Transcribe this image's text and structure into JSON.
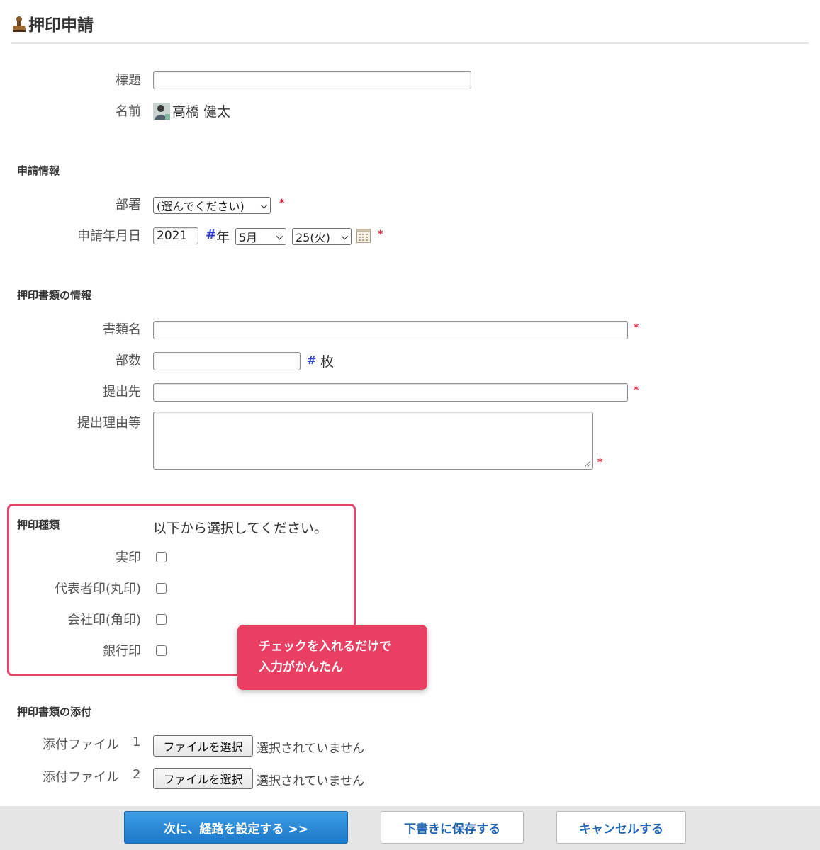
{
  "page": {
    "title": "押印申請"
  },
  "basic": {
    "title_label": "標題",
    "title_value": "",
    "name_label": "名前",
    "name_value": "高橋 健太"
  },
  "application_info": {
    "section_title": "申請情報",
    "department_label": "部署",
    "department_value": "(選んでください)",
    "date_label": "申請年月日",
    "year_value": "2021",
    "year_hash": "#",
    "year_unit": "年",
    "month_value": "5月",
    "day_value": "25(火)"
  },
  "document_info": {
    "section_title": "押印書類の情報",
    "doc_name_label": "書類名",
    "doc_name_value": "",
    "copies_label": "部数",
    "copies_value": "",
    "copies_hash": "#",
    "copies_unit": "枚",
    "recipient_label": "提出先",
    "recipient_value": "",
    "reason_label": "提出理由等",
    "reason_value": ""
  },
  "required_mark": "*",
  "seal_types": {
    "section_title": "押印種類",
    "instruction": "以下から選択してください。",
    "options": [
      {
        "label": "実印",
        "checked": false
      },
      {
        "label": "代表者印(丸印)",
        "checked": false
      },
      {
        "label": "会社印(角印)",
        "checked": false
      },
      {
        "label": "銀行印",
        "checked": false
      }
    ]
  },
  "callout": {
    "line1": "チェックを入れるだけで",
    "line2": "入力がかんたん",
    "color": "#e83f62"
  },
  "attachments": {
    "section_title": "押印書類の添付",
    "items": [
      {
        "label": "添付ファイル",
        "number": "1",
        "button": "ファイルを選択",
        "status": "選択されていません"
      },
      {
        "label": "添付ファイル",
        "number": "2",
        "button": "ファイルを選択",
        "status": "選択されていません"
      }
    ]
  },
  "footer": {
    "next_button": "次に、経路を設定する >>",
    "draft_button": "下書きに保存する",
    "cancel_button": "キャンセルする"
  },
  "colors": {
    "accent_blue": "#1e79c8",
    "required_red": "#e0203a",
    "highlight_pink": "#e2446a",
    "link_blue": "#1f64b3"
  },
  "icons": {
    "page_icon": "stamp-icon",
    "avatar": "user-avatar",
    "calendar": "calendar-icon"
  }
}
